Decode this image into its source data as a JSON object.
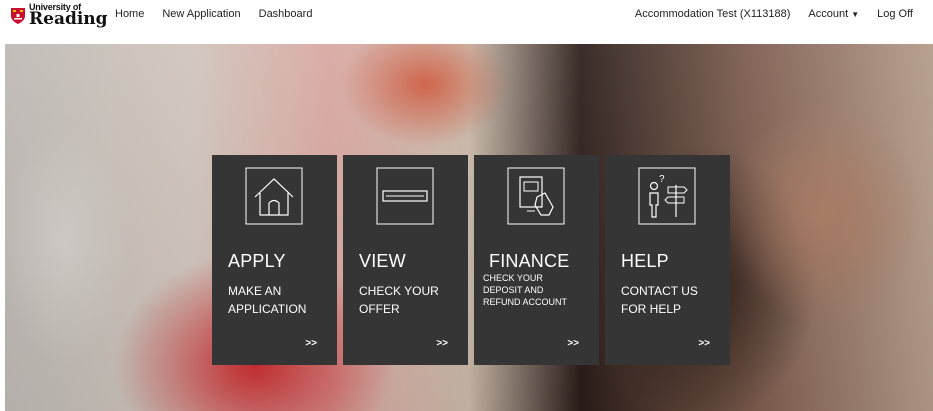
{
  "brand": {
    "line1": "University of",
    "line2": "Reading"
  },
  "nav": {
    "home": "Home",
    "new_application": "New Application",
    "dashboard": "Dashboard",
    "user": "Accommodation Test (X113188)",
    "account": "Account",
    "logoff": "Log Off"
  },
  "tiles": [
    {
      "title": "APPLY",
      "subtitle_line1": "MAKE AN",
      "subtitle_line2": "APPLICATION",
      "arrow": ">>",
      "icon": "house-icon"
    },
    {
      "title": "VIEW",
      "subtitle_line1": "CHECK YOUR",
      "subtitle_line2": "OFFER",
      "arrow": ">>",
      "icon": "document-icon"
    },
    {
      "title": "FINANCE",
      "subtitle_line1": "CHECK YOUR",
      "subtitle_line2": "DEPOSIT AND",
      "subtitle_line3": "REFUND ACCOUNT",
      "arrow": ">>",
      "icon": "card-payment-icon"
    },
    {
      "title": "HELP",
      "subtitle_line1": "CONTACT US",
      "subtitle_line2": "FOR HELP",
      "arrow": ">>",
      "icon": "help-signpost-icon"
    }
  ],
  "colors": {
    "tile_bg": "#353535",
    "crest_red": "#c8102e"
  }
}
